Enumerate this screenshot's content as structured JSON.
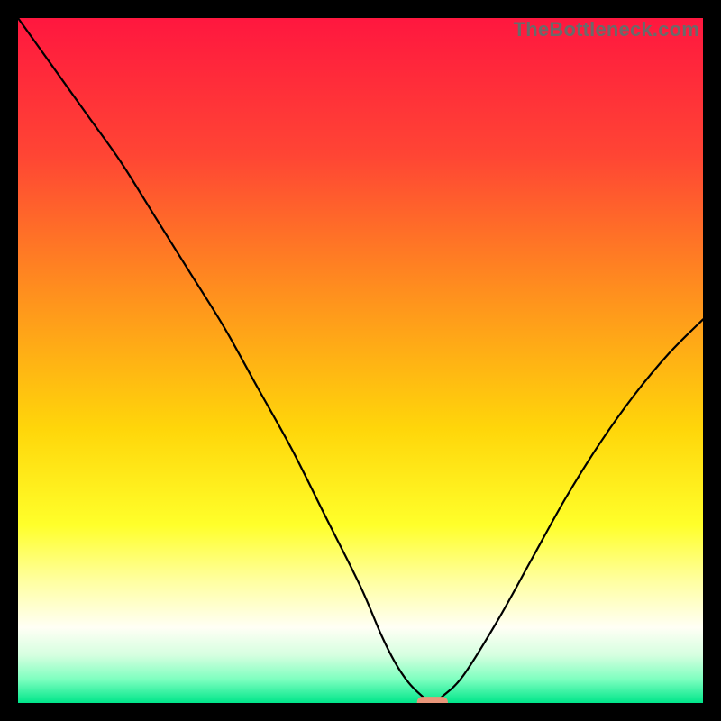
{
  "watermark": "TheBottleneck.com",
  "chart_data": {
    "type": "line",
    "title": "",
    "xlabel": "",
    "ylabel": "",
    "xlim": [
      0,
      100
    ],
    "ylim": [
      0,
      100
    ],
    "grid": false,
    "legend": false,
    "gradient_stops": [
      {
        "offset": 0.0,
        "color": "#ff173f"
      },
      {
        "offset": 0.2,
        "color": "#ff4534"
      },
      {
        "offset": 0.4,
        "color": "#ff8f1e"
      },
      {
        "offset": 0.6,
        "color": "#ffd60a"
      },
      {
        "offset": 0.74,
        "color": "#ffff2a"
      },
      {
        "offset": 0.82,
        "color": "#ffff9e"
      },
      {
        "offset": 0.89,
        "color": "#fffff5"
      },
      {
        "offset": 0.93,
        "color": "#d6ffe0"
      },
      {
        "offset": 0.965,
        "color": "#7fffc0"
      },
      {
        "offset": 1.0,
        "color": "#00e68a"
      }
    ],
    "series": [
      {
        "name": "bottleneck-curve",
        "x": [
          0,
          5,
          10,
          15,
          20,
          25,
          30,
          35,
          40,
          45,
          50,
          53,
          55,
          57,
          59,
          60.5,
          62,
          65,
          70,
          75,
          80,
          85,
          90,
          95,
          100
        ],
        "values": [
          100,
          93,
          86,
          79,
          71,
          63,
          55,
          46,
          37,
          27,
          17,
          10,
          6,
          3,
          1,
          0,
          1,
          4,
          12,
          21,
          30,
          38,
          45,
          51,
          56
        ]
      }
    ],
    "marker": {
      "name": "target-marker",
      "x": 60.5,
      "y": 0,
      "width_frac": 0.045,
      "height_frac": 0.018,
      "color": "#e9967a"
    }
  }
}
